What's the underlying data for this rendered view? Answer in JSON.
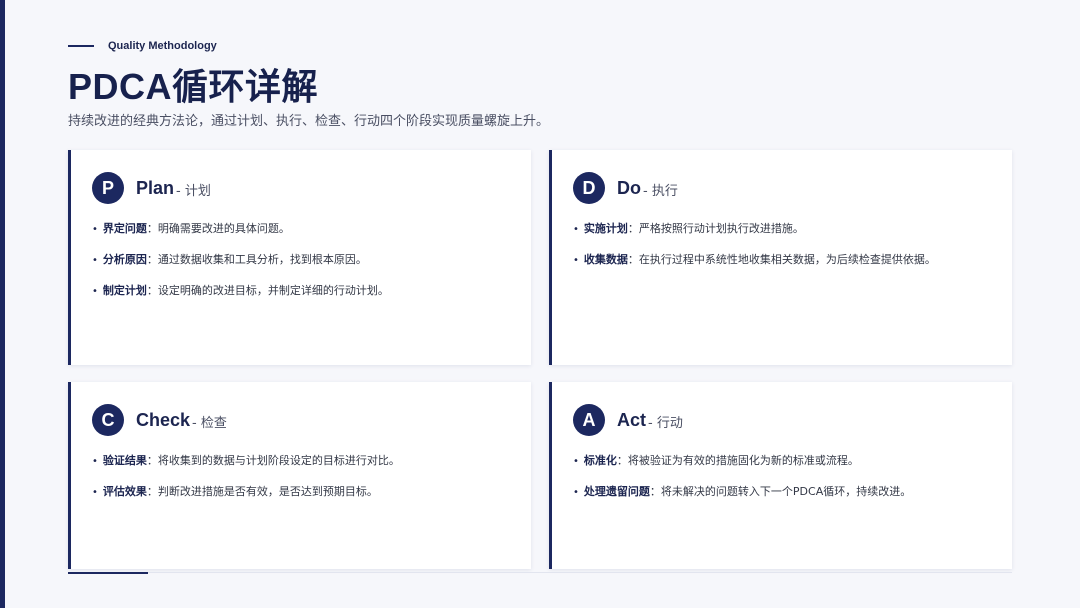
{
  "header": {
    "eyebrow": "Quality Methodology",
    "title": "PDCA循环详解",
    "subtitle": "持续改进的经典方法论，通过计划、执行、检查、行动四个阶段实现质量螺旋上升。"
  },
  "colors": {
    "primary": "#1c2860",
    "background": "#f6f7fb",
    "card": "#ffffff"
  },
  "cards": [
    {
      "letter": "P",
      "title_en": "Plan",
      "title_cn": "- 计划",
      "items": [
        {
          "term": "界定问题",
          "sep": "：",
          "desc": "明确需要改进的具体问题。"
        },
        {
          "term": "分析原因",
          "sep": "：",
          "desc": "通过数据收集和工具分析，找到根本原因。"
        },
        {
          "term": "制定计划",
          "sep": "：",
          "desc": "设定明确的改进目标，并制定详细的行动计划。"
        }
      ]
    },
    {
      "letter": "D",
      "title_en": "Do",
      "title_cn": "- 执行",
      "items": [
        {
          "term": "实施计划",
          "sep": "：",
          "desc": "严格按照行动计划执行改进措施。"
        },
        {
          "term": "收集数据",
          "sep": "：",
          "desc": "在执行过程中系统性地收集相关数据，为后续检查提供依据。"
        }
      ]
    },
    {
      "letter": "C",
      "title_en": "Check",
      "title_cn": "- 检查",
      "items": [
        {
          "term": "验证结果",
          "sep": "：",
          "desc": "将收集到的数据与计划阶段设定的目标进行对比。"
        },
        {
          "term": "评估效果",
          "sep": "：",
          "desc": "判断改进措施是否有效，是否达到预期目标。"
        }
      ]
    },
    {
      "letter": "A",
      "title_en": "Act",
      "title_cn": "- 行动",
      "items": [
        {
          "term": "标准化",
          "sep": "：",
          "desc": "将被验证为有效的措施固化为新的标准或流程。"
        },
        {
          "term": "处理遗留问题",
          "sep": "：",
          "desc": "将未解决的问题转入下一个PDCA循环，持续改进。"
        }
      ]
    }
  ]
}
